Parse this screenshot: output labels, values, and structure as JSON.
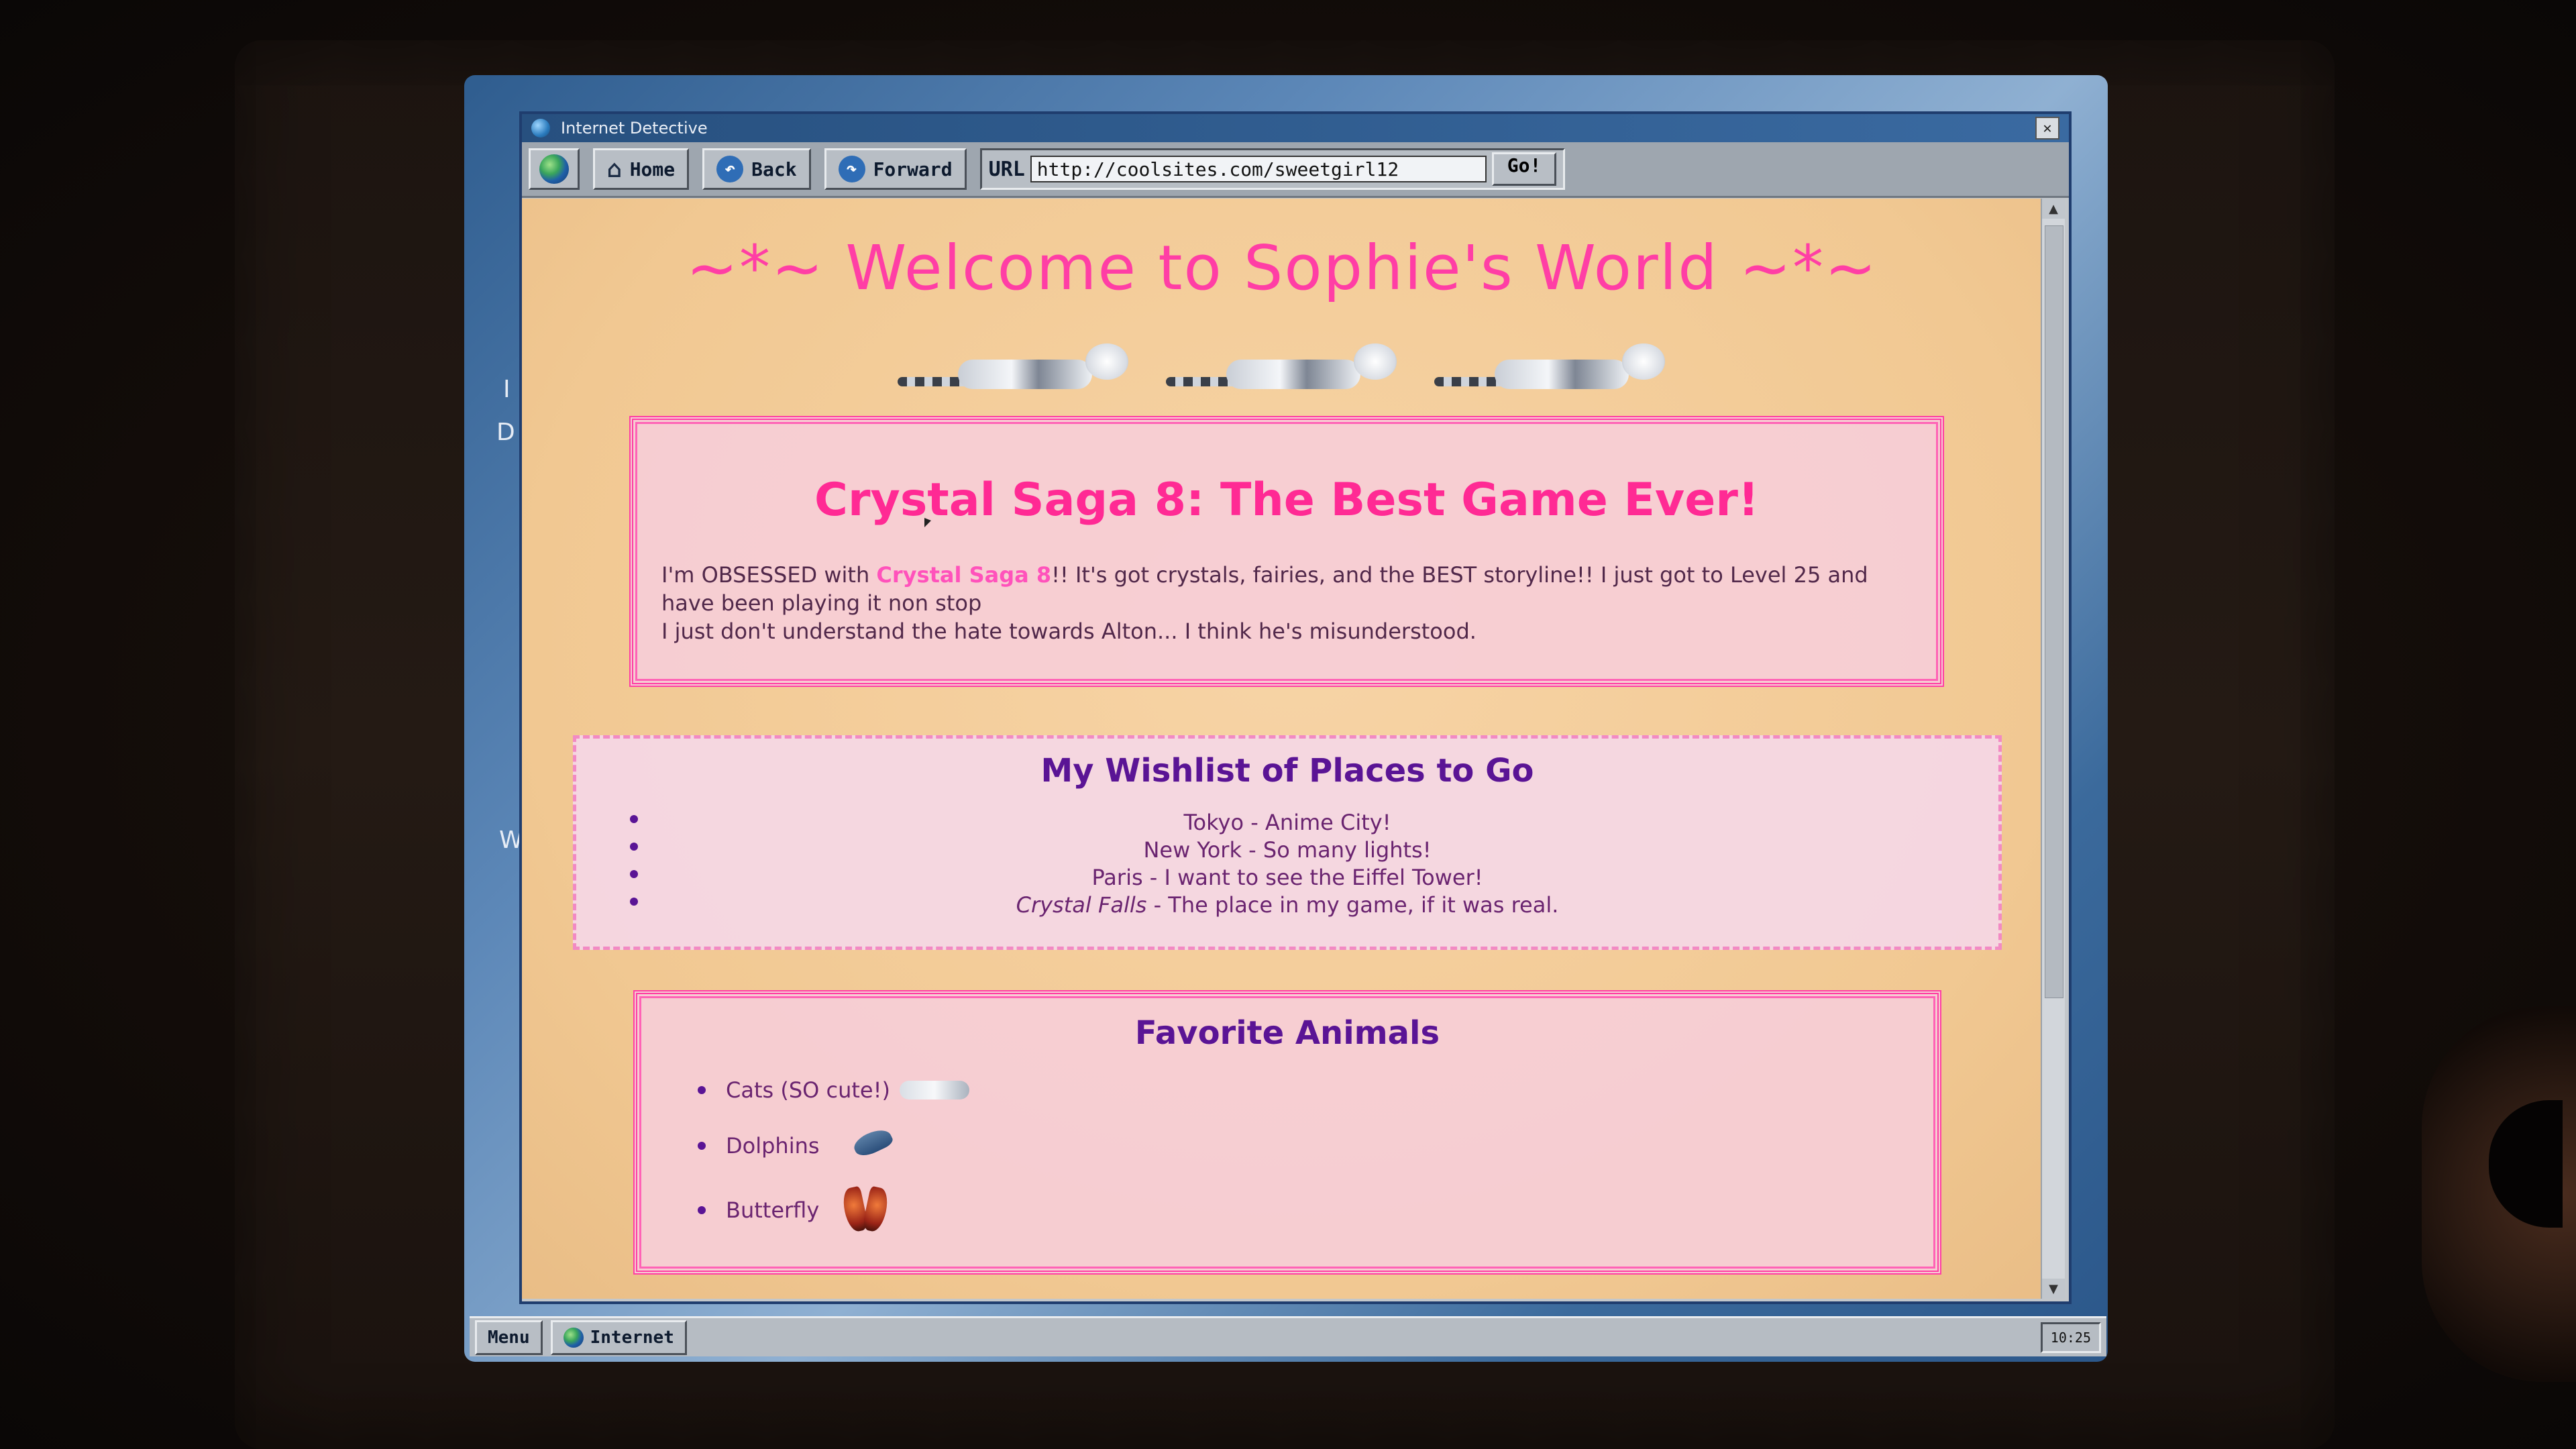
{
  "window": {
    "title": "Internet Detective",
    "close_label": "✕"
  },
  "toolbar": {
    "home_label": "Home",
    "back_label": "Back",
    "forward_label": "Forward",
    "url_label": "URL",
    "url_value": "http://coolsites.com/sweetgirl12",
    "go_label": "Go!"
  },
  "desktop": {
    "labels": [
      "I",
      "D",
      "W"
    ]
  },
  "page": {
    "welcome": "~*~ Welcome to Sophie's World ~*~",
    "crystal": {
      "heading": "Crystal Saga 8: The Best Game Ever!",
      "p1_before": "I'm OBSESSED with ",
      "p1_highlight": "Crystal Saga 8",
      "p1_after": "!! It's got crystals, fairies, and the BEST storyline!! I just got to Level 25 and have been playing it non stop",
      "p2": "I just don't understand the hate towards Alton... I think he's misunderstood."
    },
    "wishlist": {
      "heading": "My Wishlist of Places to Go",
      "items": [
        "Tokyo - Anime City!",
        "New York - So many lights!",
        "Paris - I want to see the Eiffel Tower!",
        "Crystal Falls - The place in my game, if it was real."
      ],
      "item4_italic": "Crystal Falls",
      "item4_rest": " - The place in my game, if it was real."
    },
    "animals": {
      "heading": "Favorite Animals",
      "items": [
        "Cats (SO cute!)",
        "Dolphins",
        "Butterfly"
      ]
    }
  },
  "taskbar": {
    "menu_label": "Menu",
    "internet_label": "Internet",
    "clock": "10:25"
  },
  "colors": {
    "title_pink": "#ff3ea5",
    "heading_purple": "#5a1495",
    "page_bg": "#f1c892"
  }
}
